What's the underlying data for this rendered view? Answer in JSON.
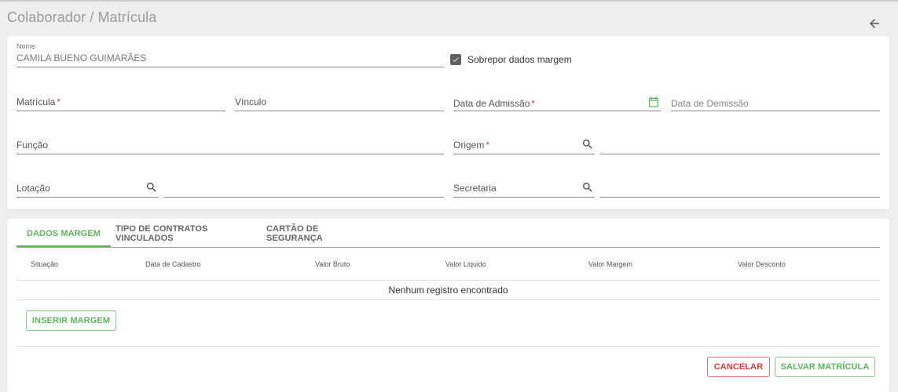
{
  "header": {
    "title": "Colaborador / Matrícula",
    "back_icon": "arrow-left-icon"
  },
  "form": {
    "nome": {
      "label": "Nome",
      "value": "CAMILA BUENO GUIMARÃES"
    },
    "sobrepor": {
      "label": "Sobrepor dados margem",
      "checked": true
    },
    "matricula": {
      "label": "Matrícula",
      "required_mark": "*"
    },
    "vinculo": {
      "label": "Vínculo"
    },
    "data_admissao": {
      "label": "Data de Admissão",
      "required_mark": "*",
      "icon": "calendar-icon"
    },
    "data_demissao": {
      "label": "Data de Demissão"
    },
    "funcao": {
      "label": "Função"
    },
    "origem": {
      "label": "Origem",
      "required_mark": "*",
      "icon": "search-icon"
    },
    "lotacao": {
      "label": "Lotação",
      "icon": "search-icon"
    },
    "secretaria": {
      "label": "Secretaria",
      "icon": "search-icon"
    }
  },
  "tabs": [
    {
      "label": "DADOS MARGEM",
      "active": true
    },
    {
      "label": "TIPO DE CONTRATOS VINCULADOS",
      "active": false
    },
    {
      "label": "CARTÃO DE SEGURANÇA",
      "active": false
    }
  ],
  "table": {
    "columns": [
      "Situação",
      "Data de Cadastro",
      "Valor Bruto",
      "Valor Liquido",
      "Valor Margem",
      "Valor Desconto"
    ],
    "empty_message": "Nenhum registro encontrado"
  },
  "buttons": {
    "inserir_margem": "INSERIR MARGEM",
    "cancelar": "CANCELAR",
    "salvar": "SALVAR MATRÍCULA"
  },
  "colors": {
    "accent": "#5cb85c",
    "danger": "#e53935",
    "background": "#eeeeee"
  }
}
